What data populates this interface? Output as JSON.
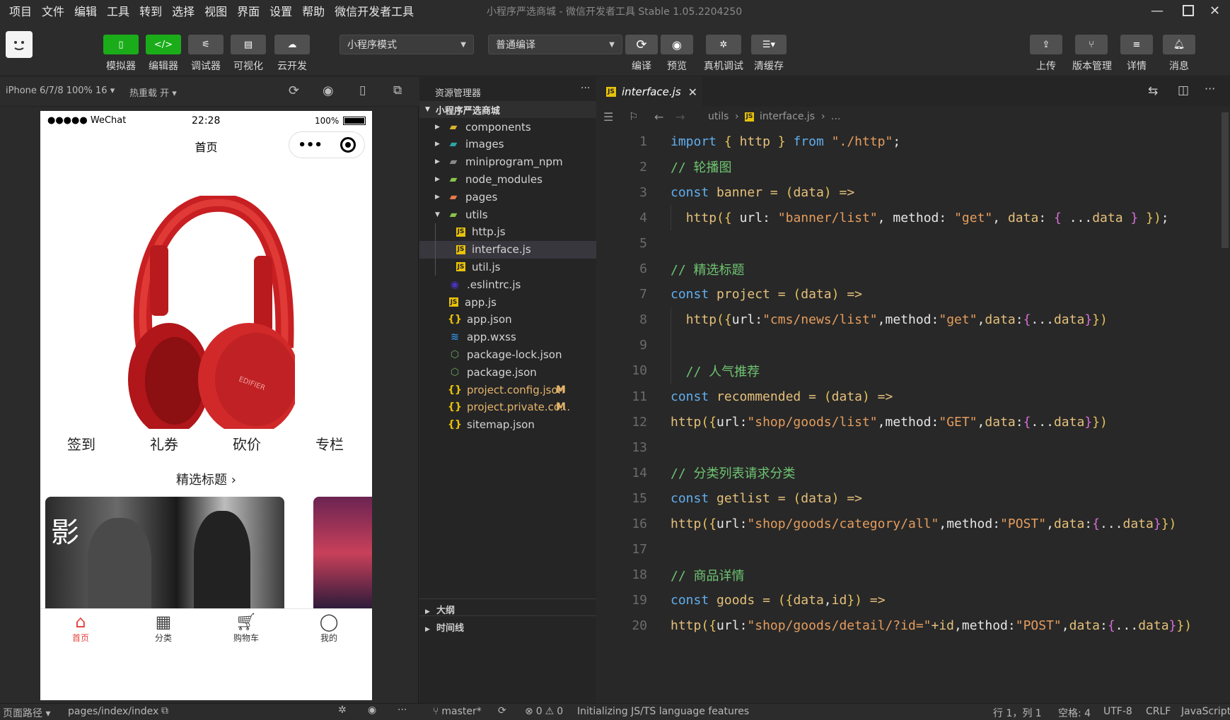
{
  "menu": [
    "项目",
    "文件",
    "编辑",
    "工具",
    "转到",
    "选择",
    "视图",
    "界面",
    "设置",
    "帮助",
    "微信开发者工具"
  ],
  "window_title": "小程序严选商城 - 微信开发者工具 Stable 1.05.2204250",
  "toolbar": {
    "simulator": "模拟器",
    "editor": "编辑器",
    "debugger": "调试器",
    "visual": "可视化",
    "cloud": "云开发",
    "mode": "小程序模式",
    "compile_mode": "普通编译",
    "compile": "编译",
    "preview": "预览",
    "real_debug": "真机调试",
    "clear_cache": "清缓存",
    "upload": "上传",
    "version": "版本管理",
    "details": "详情",
    "messages": "消息"
  },
  "simbar": {
    "device": "iPhone 6/7/8 100% 16",
    "hotreload": "热重载 开"
  },
  "phone": {
    "carrier": "●●●●● WeChat",
    "time": "22:28",
    "battery": "100%",
    "page_title": "首页",
    "capsule_dots": "•••",
    "nav": [
      "签到",
      "礼券",
      "砍价",
      "专栏"
    ],
    "section_title": "精选标题",
    "section_arrow": "›",
    "tabbar": [
      "首页",
      "分类",
      "购物车",
      "我的"
    ],
    "accent": "#e64340"
  },
  "explorer": {
    "title": "资源管理器",
    "more": "···",
    "project": "小程序严选商城",
    "items": [
      {
        "name": "components",
        "icon": "folder-yellow"
      },
      {
        "name": "images",
        "icon": "folder-teal"
      },
      {
        "name": "miniprogram_npm",
        "icon": "folder-gray"
      },
      {
        "name": "node_modules",
        "icon": "folder-green"
      },
      {
        "name": "pages",
        "icon": "folder-orange"
      },
      {
        "name": "utils",
        "icon": "folder-green-open"
      },
      {
        "name": "http.js",
        "icon": "js"
      },
      {
        "name": "interface.js",
        "icon": "js"
      },
      {
        "name": "util.js",
        "icon": "js"
      },
      {
        "name": ".eslintrc.js",
        "icon": "eslint"
      },
      {
        "name": "app.js",
        "icon": "js"
      },
      {
        "name": "app.json",
        "icon": "json"
      },
      {
        "name": "app.wxss",
        "icon": "css"
      },
      {
        "name": "package-lock.json",
        "icon": "node"
      },
      {
        "name": "package.json",
        "icon": "node"
      },
      {
        "name": "project.config.json",
        "icon": "json",
        "badge": "M"
      },
      {
        "name": "project.private.co...",
        "icon": "json",
        "badge": "M"
      },
      {
        "name": "sitemap.json",
        "icon": "json"
      }
    ],
    "outline": "大纲",
    "timeline": "时间线"
  },
  "editor": {
    "tab": "interface.js",
    "breadcrumb": [
      "utils",
      "interface.js",
      "..."
    ],
    "lines": [
      {
        "n": "1",
        "t": "import { http } from \"./http\";"
      },
      {
        "n": "2",
        "t": "// 轮播图"
      },
      {
        "n": "3",
        "t": "const banner = (data) =>"
      },
      {
        "n": "4",
        "t": "  http({ url: \"banner/list\", method: \"get\", data: { ...data } });"
      },
      {
        "n": "5",
        "t": ""
      },
      {
        "n": "6",
        "t": "// 精选标题"
      },
      {
        "n": "7",
        "t": "const project = (data) =>"
      },
      {
        "n": "8",
        "t": "  http({url:\"cms/news/list\",method:\"get\",data:{...data}})"
      },
      {
        "n": "9",
        "t": ""
      },
      {
        "n": "10",
        "t": "  // 人气推荐"
      },
      {
        "n": "11",
        "t": "const recommended = (data) =>"
      },
      {
        "n": "12",
        "t": "http({url:\"shop/goods/list\",method:\"GET\",data:{...data}})"
      },
      {
        "n": "13",
        "t": ""
      },
      {
        "n": "14",
        "t": "// 分类列表请求分类"
      },
      {
        "n": "15",
        "t": "const getlist = (data) =>"
      },
      {
        "n": "16",
        "t": "http({url:\"shop/goods/category/all\",method:\"POST\",data:{...data}})"
      },
      {
        "n": "17",
        "t": ""
      },
      {
        "n": "18",
        "t": "// 商品详情"
      },
      {
        "n": "19",
        "t": "const goods = ({data,id}) =>"
      },
      {
        "n": "20",
        "t": "http({url:\"shop/goods/detail/?id=\"+id,method:\"POST\",data:{...data}})"
      }
    ]
  },
  "status": {
    "page_path_label": "页面路径",
    "page_path": "pages/index/index",
    "branch": "master*",
    "problems": "0",
    "warnings": "0",
    "message": "Initializing JS/TS language features",
    "position": "行 1，列 1",
    "spaces": "空格: 4",
    "encoding": "UTF-8",
    "eol": "CRLF",
    "language": "JavaScript"
  }
}
